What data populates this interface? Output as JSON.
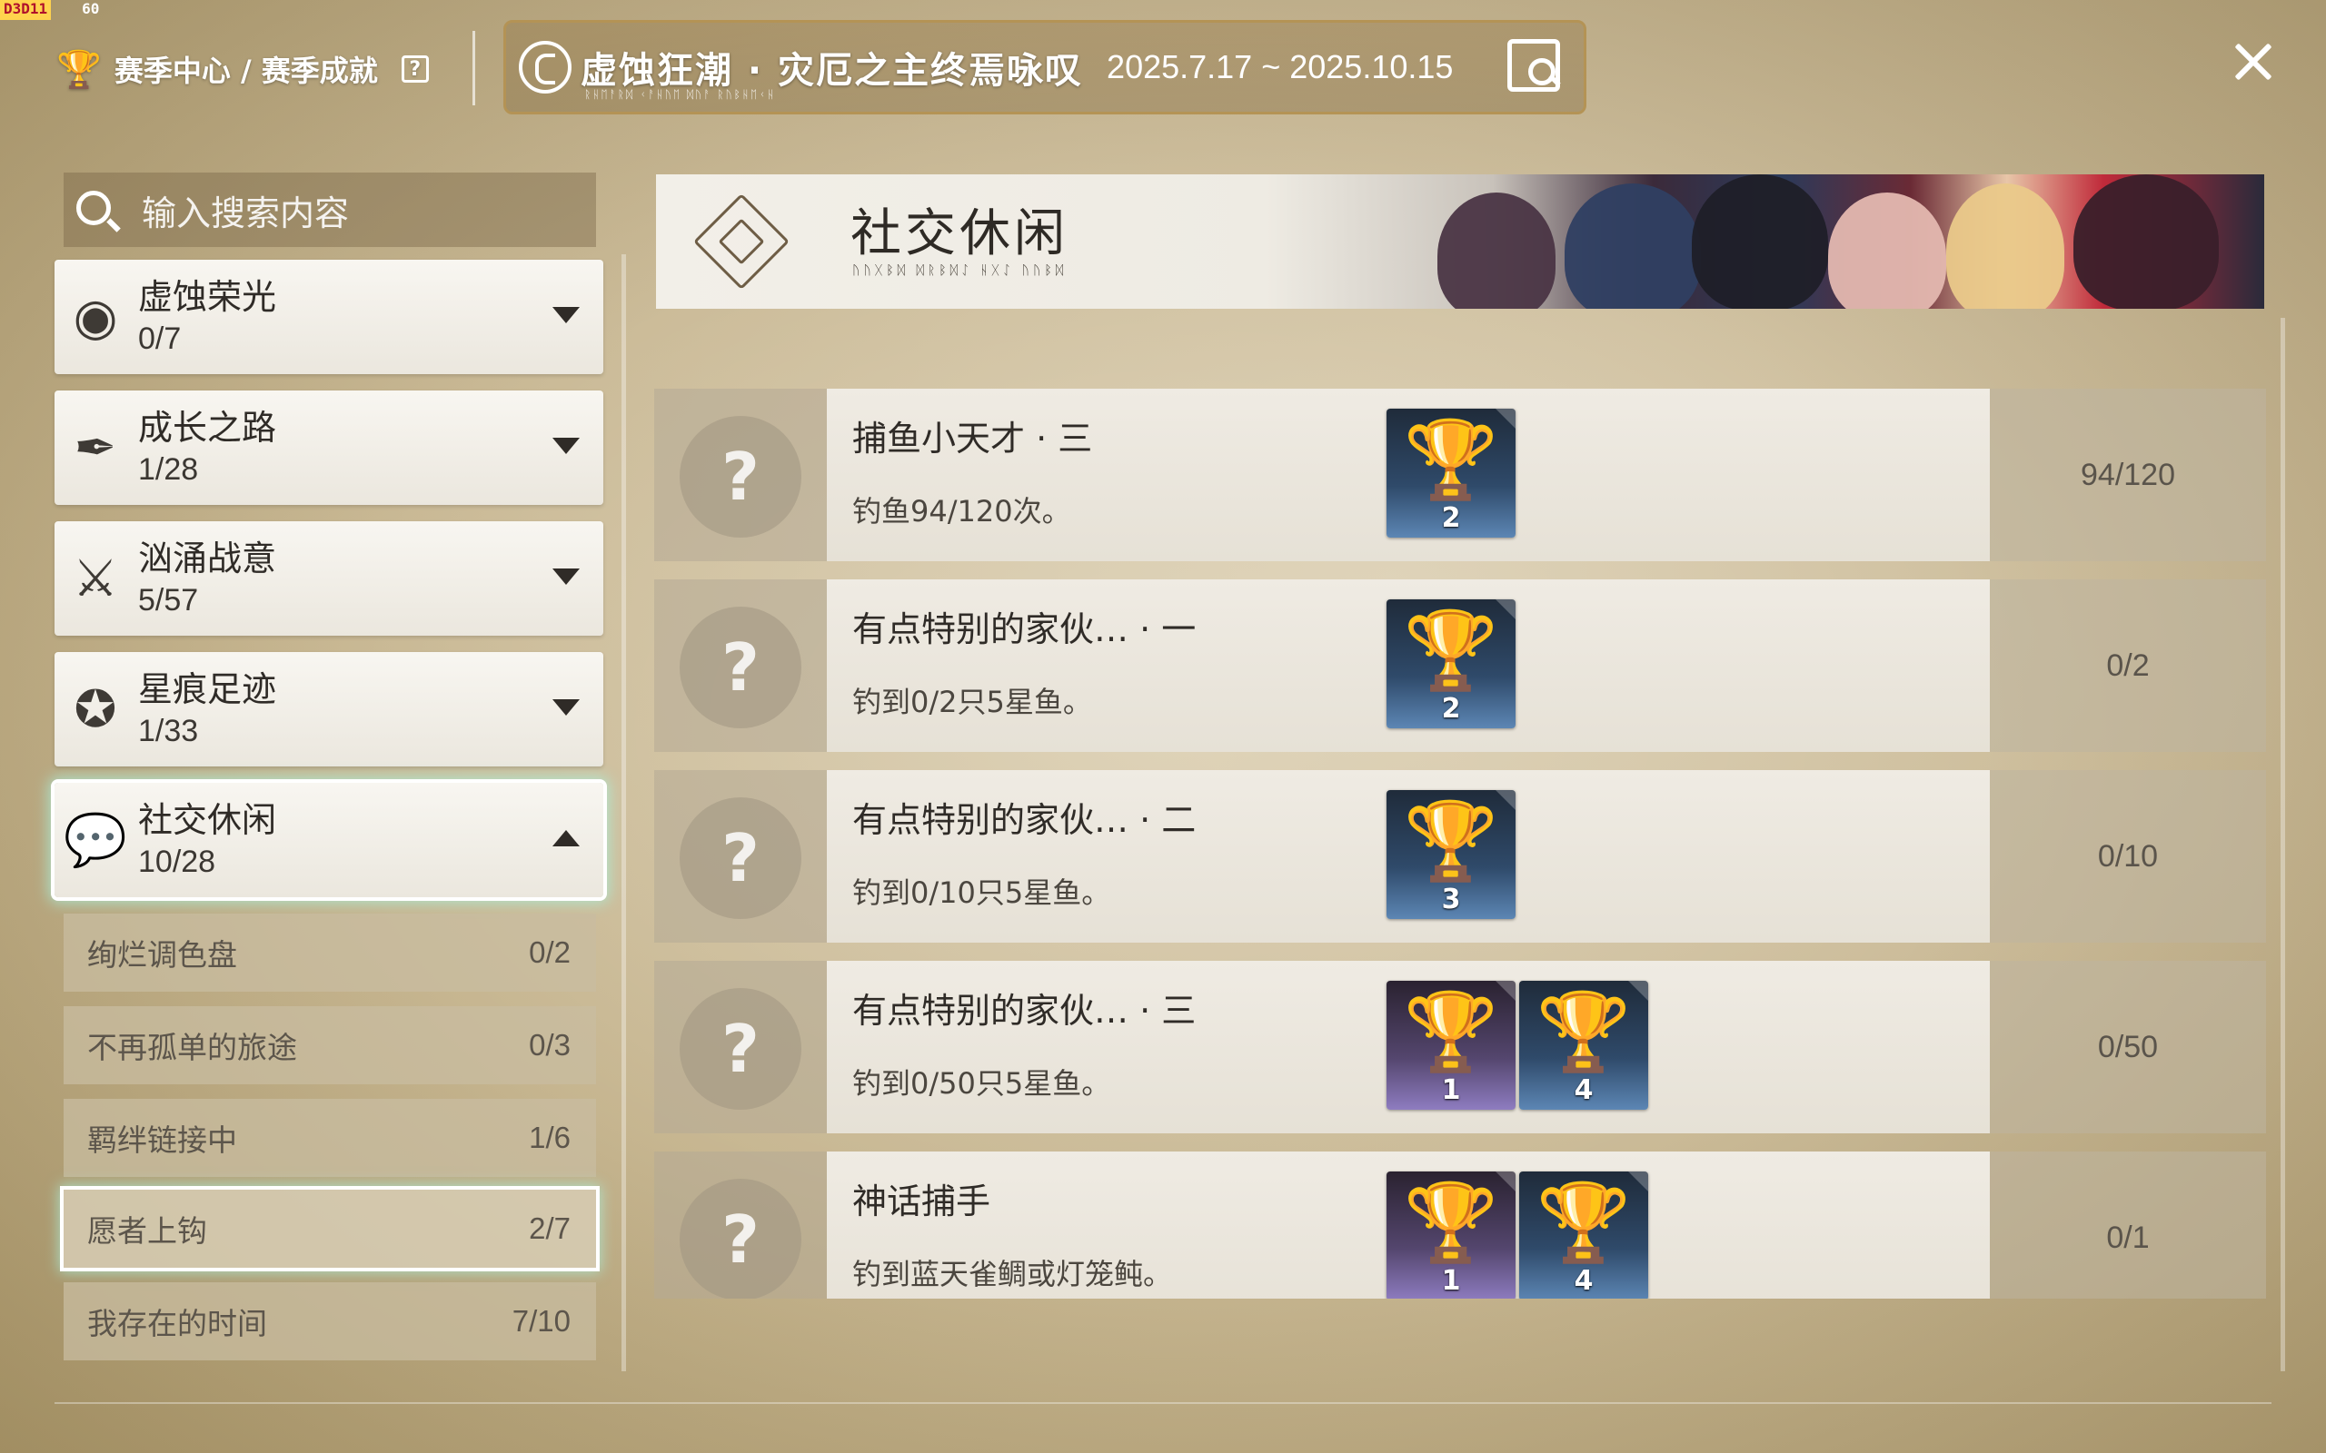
{
  "debug": {
    "tag": "D3D11",
    "fps": "60"
  },
  "breadcrumb": {
    "text": "赛季中心 / 赛季成就",
    "help": "?"
  },
  "season": {
    "title": "虚蚀狂潮 · 灾厄之主终焉咏叹",
    "subtitle": "ᚱᚺᛖᚨᚱᛞ ᚲᚨᚺᚢᛖ ᛞᚢᚨ ᚱᚢᛒᚺᛖᚲᚺ",
    "dates": "2025.7.17 ~ 2025.10.15"
  },
  "search": {
    "placeholder": "输入搜索内容"
  },
  "categories": [
    {
      "name": "虚蚀荣光",
      "count": "0/7",
      "icon": "eye-icon"
    },
    {
      "name": "成长之路",
      "count": "1/28",
      "icon": "quill-book-icon"
    },
    {
      "name": "汹涌战意",
      "count": "5/57",
      "icon": "crossed-weapons-icon"
    },
    {
      "name": "星痕足迹",
      "count": "1/33",
      "icon": "footprint-icon"
    },
    {
      "name": "社交休闲",
      "count": "10/28",
      "icon": "chat-bubbles-icon"
    }
  ],
  "subcategories": [
    {
      "name": "绚烂调色盘",
      "count": "0/2"
    },
    {
      "name": "不再孤单的旅途",
      "count": "0/3"
    },
    {
      "name": "羁绊链接中",
      "count": "1/6"
    },
    {
      "name": "愿者上钩",
      "count": "2/7"
    },
    {
      "name": "我存在的时间",
      "count": "7/10"
    }
  ],
  "banner": {
    "title": "社交休闲",
    "subtitle": "ᚢᚢᚷᛒᛞ ᛞᚱᛒᛞᛇ ᚺᚷᛇ ᚢᚢᛒᛞ"
  },
  "achievements": [
    {
      "title": "捕鱼小天才 · 三",
      "desc": "钓鱼94/120次。",
      "progress": "94/120",
      "rewards": [
        {
          "tier": "silver",
          "amount": "2"
        }
      ]
    },
    {
      "title": "有点特别的家伙… · 一",
      "desc": "钓到0/2只5星鱼。",
      "progress": "0/2",
      "rewards": [
        {
          "tier": "silver",
          "amount": "2"
        }
      ]
    },
    {
      "title": "有点特别的家伙… · 二",
      "desc": "钓到0/10只5星鱼。",
      "progress": "0/10",
      "rewards": [
        {
          "tier": "silver",
          "amount": "3"
        }
      ]
    },
    {
      "title": "有点特别的家伙… · 三",
      "desc": "钓到0/50只5星鱼。",
      "progress": "0/50",
      "rewards": [
        {
          "tier": "gold",
          "amount": "1"
        },
        {
          "tier": "silver",
          "amount": "4"
        }
      ]
    },
    {
      "title": "神话捕手",
      "desc": "钓到蓝天雀鲷或灯笼鲀。",
      "progress": "0/1",
      "rewards": [
        {
          "tier": "gold",
          "amount": "1"
        },
        {
          "tier": "silver",
          "amount": "4"
        }
      ]
    }
  ],
  "colors": {
    "accent_glow": "#aaf0dc",
    "gold": "#e0b646",
    "silver": "#cdd3da"
  }
}
